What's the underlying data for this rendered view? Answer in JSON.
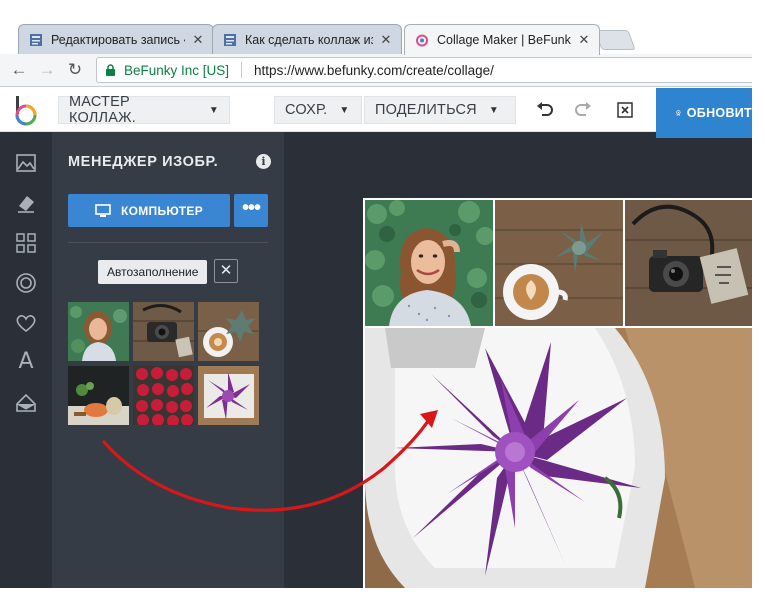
{
  "browser": {
    "tabs": [
      {
        "title": "Редактировать запись ‹",
        "active": false
      },
      {
        "title": "Как сделать коллаж из ф",
        "active": false
      },
      {
        "title": "Collage Maker | BeFunky",
        "active": true
      }
    ],
    "security_label": "BeFunky Inc [US]",
    "url": "https://www.befunky.com/create/collage/"
  },
  "appbar": {
    "layout_menu": "МАСТЕР КОЛЛАЖ.",
    "save_menu": "СОХР.",
    "share_menu": "ПОДЕЛИТЬСЯ",
    "upgrade_label": "ОБНОВИТ"
  },
  "panel": {
    "title": "МЕНЕДЖЕР ИЗОБР.",
    "info_glyph": "i",
    "computer_button": "КОМПЬЮТЕР",
    "more_glyph": "•••",
    "autofill_button": "Автозаполнение",
    "autofill_clear_glyph": "✕",
    "thumbnails": [
      "woman",
      "camera",
      "coffee",
      "food",
      "raspberries",
      "succulent"
    ]
  },
  "rail": {
    "icons": [
      "image-icon",
      "eraser-icon",
      "grid-icon",
      "circle-icon",
      "heart-icon",
      "text-icon",
      "shape-icon"
    ],
    "text_glyph": "A"
  },
  "collage": {
    "cells": [
      "woman",
      "coffee-succulent",
      "camera",
      "purple-succulent"
    ]
  },
  "colors": {
    "accent": "#3a86d3",
    "upgrade": "#2f84d0",
    "panel": "#363c45",
    "rail": "#2b3038",
    "arrow": "#d81818"
  }
}
